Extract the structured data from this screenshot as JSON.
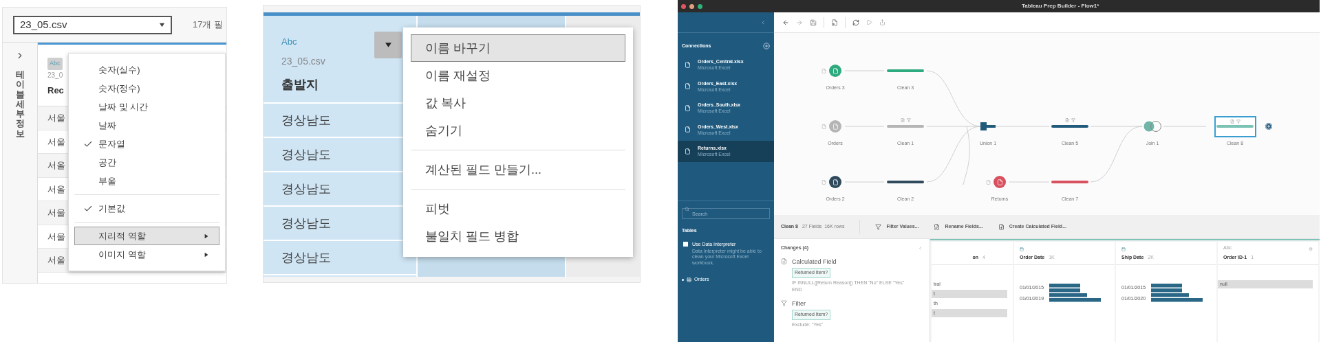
{
  "type_menu_panel": {
    "file_select": "23_05.csv",
    "field_count": "17개 필",
    "side_label": "테이블 세부 정보",
    "column": {
      "type_badge": "Abc",
      "source": "23_0",
      "name": "Rec"
    },
    "rows": [
      "서울",
      "서울",
      "서울",
      "서울",
      "서울",
      "서울",
      "서울"
    ],
    "menu_groups": [
      {
        "items": [
          {
            "label": "숫자(실수)",
            "checked": false,
            "submenu": false,
            "selected": false
          },
          {
            "label": "숫자(정수)",
            "checked": false,
            "submenu": false,
            "selected": false
          },
          {
            "label": "날짜 및 시간",
            "checked": false,
            "submenu": false,
            "selected": false
          },
          {
            "label": "날짜",
            "checked": false,
            "submenu": false,
            "selected": false
          },
          {
            "label": "문자열",
            "checked": true,
            "submenu": false,
            "selected": false
          },
          {
            "label": "공간",
            "checked": false,
            "submenu": false,
            "selected": false
          },
          {
            "label": "부울",
            "checked": false,
            "submenu": false,
            "selected": false
          }
        ]
      },
      {
        "items": [
          {
            "label": "기본값",
            "checked": true,
            "submenu": false,
            "selected": false
          }
        ]
      },
      {
        "items": [
          {
            "label": "지리적 역할",
            "checked": false,
            "submenu": true,
            "selected": true
          },
          {
            "label": "이미지 역할",
            "checked": false,
            "submenu": true,
            "selected": false
          }
        ]
      }
    ]
  },
  "field_menu_panel": {
    "column": {
      "type_badge": "Abc",
      "source": "23_05.csv",
      "name": "출발지",
      "selected": true
    },
    "rows": [
      "경상남도",
      "경상남도",
      "경상남도",
      "경상남도",
      "경상남도"
    ],
    "menu_groups": [
      {
        "items": [
          {
            "label": "이름 바꾸기",
            "selected": true
          },
          {
            "label": "이름 재설정",
            "selected": false
          },
          {
            "label": "값 복사",
            "selected": false
          },
          {
            "label": "숨기기",
            "selected": false
          }
        ]
      },
      {
        "items": [
          {
            "label": "계산된 필드 만들기...",
            "selected": false
          }
        ]
      },
      {
        "items": [
          {
            "label": "피벗",
            "selected": false
          },
          {
            "label": "불일치 필드 병합",
            "selected": false
          }
        ]
      }
    ]
  },
  "prep_window": {
    "title": "Tableau Prep Builder - Flow1*",
    "sidebar": {
      "connections_heading": "Connections",
      "connections": [
        {
          "name": "Orders_Central.xlsx",
          "type": "Microsoft Excel",
          "selected": false
        },
        {
          "name": "Orders_East.xlsx",
          "type": "Microsoft Excel",
          "selected": false
        },
        {
          "name": "Orders_South.xlsx",
          "type": "Microsoft Excel",
          "selected": false
        },
        {
          "name": "Orders_West.xlsx",
          "type": "Microsoft Excel",
          "selected": false
        },
        {
          "name": "Returns.xlsx",
          "type": "Microsoft Excel",
          "selected": true
        }
      ],
      "search": {
        "placeholder": "Search"
      },
      "tables_heading": "Tables",
      "interpreter": {
        "label": "Use Data Interpreter",
        "checked": false,
        "description": "Data Interpreter might be able to clean your Microsoft Excel workbook."
      },
      "tables": [
        {
          "name": "Orders"
        }
      ]
    },
    "flow_nodes": [
      {
        "label": "Orders 3",
        "kind": "input",
        "color": "#2eaa7f"
      },
      {
        "label": "Clean 3",
        "kind": "clean",
        "color": "#2eaa7f",
        "annotated": false,
        "selected": false
      },
      {
        "label": "Orders",
        "kind": "input",
        "color": "#b5b5b5"
      },
      {
        "label": "Clean 1",
        "kind": "clean",
        "color": "#b5b5b5",
        "annotated": true,
        "selected": false
      },
      {
        "label": "Orders 2",
        "kind": "input",
        "color": "#2f4a5c"
      },
      {
        "label": "Clean 2",
        "kind": "clean",
        "color": "#2f4a5c",
        "annotated": false,
        "selected": false
      },
      {
        "label": "Union 1",
        "kind": "union",
        "color": "#225a7c"
      },
      {
        "label": "Returns",
        "kind": "input",
        "color": "#d9505e"
      },
      {
        "label": "Clean 5",
        "kind": "clean",
        "color": "#225a7c",
        "annotated": true,
        "selected": false
      },
      {
        "label": "Clean 7",
        "kind": "clean",
        "color": "#d9505e",
        "annotated": false,
        "selected": false
      },
      {
        "label": "Join 1",
        "kind": "join",
        "color": "#6fb5a8"
      },
      {
        "label": "Clean 8",
        "kind": "clean",
        "color": "#7cc2b5",
        "annotated": true,
        "selected": true
      }
    ],
    "profile": {
      "step": "Clean 8",
      "stats": "27 Fields  16K rows",
      "actions": [
        {
          "label": "Filter Values...",
          "kind": "filter"
        },
        {
          "label": "Rename Fields...",
          "kind": "rename"
        },
        {
          "label": "Create Calculated Field...",
          "kind": "calc"
        }
      ],
      "changes": {
        "title": "Changes (4)",
        "items": [
          {
            "kind": "calc",
            "title": "Calculated Field",
            "field": "Returned Item?",
            "detail": "IF ISNULL([Return Reason]) THEN \"No\" ELSE \"Yes\" END"
          },
          {
            "kind": "filter",
            "title": "Filter",
            "field": "Returned Item?",
            "detail": "Exclude: \"Yes\""
          }
        ]
      },
      "cards": [
        {
          "kind": "partial",
          "name": "on",
          "count": "4",
          "values": [
            {
              "text": "tral",
              "highlighted": false
            },
            {
              "text": "t",
              "highlighted": true
            },
            {
              "text": "th",
              "highlighted": false
            },
            {
              "text": "t",
              "highlighted": true
            }
          ]
        },
        {
          "kind": "date",
          "name": "Order Date",
          "count": "1K",
          "labels": [
            "01/01/2015",
            "01/01/2019"
          ]
        },
        {
          "kind": "date",
          "name": "Ship Date",
          "count": "2K",
          "labels": [
            "01/01/2015",
            "01/01/2020"
          ]
        },
        {
          "kind": "string",
          "name": "Order ID-1",
          "count": "1",
          "type_badge": "Abc",
          "values": [
            {
              "text": "null",
              "highlighted": true
            }
          ]
        }
      ]
    }
  }
}
